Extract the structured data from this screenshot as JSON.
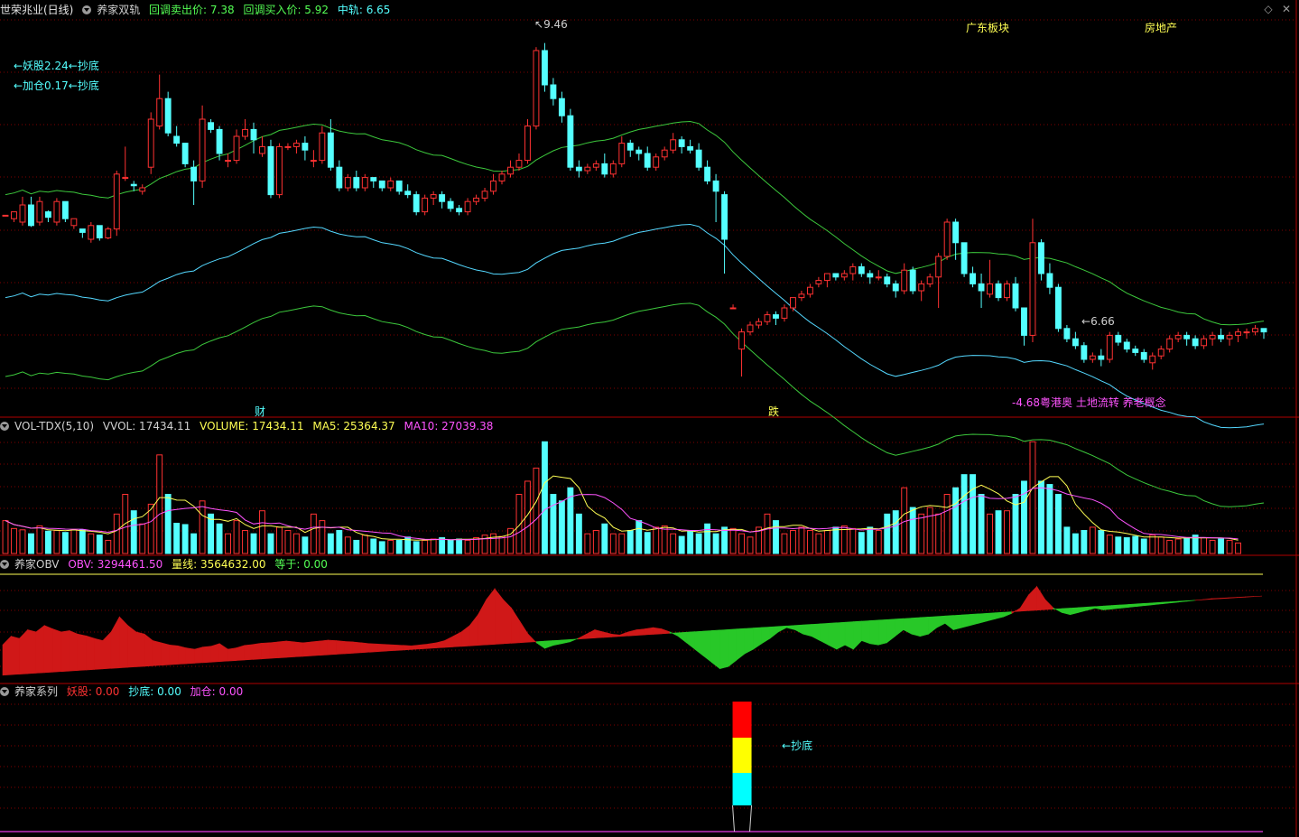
{
  "main": {
    "stock_title": "世荣兆业(日线)",
    "indicator_name": "养家双轨",
    "sell_label": "回调卖出价: 7.38",
    "buy_label": "回调买入价: 5.92",
    "mid_label": "中轨: 6.65",
    "sector_label": "广东板块",
    "industry_label": "房地产",
    "note1": "←妖股2.24←抄底",
    "note2": "←加仓0.17←抄底",
    "high_marker": "9.46",
    "low_marker": "6.66",
    "event_cai": "财",
    "event_die": "跌",
    "concept_text": "-4.68粤港奥 土地流转 养老概念"
  },
  "vol_panel": {
    "name": "VOL-TDX(5,10)",
    "vvol": "VVOL: 17434.11",
    "volume": "VOLUME: 17434.11",
    "ma5": "MA5: 25364.37",
    "ma10": "MA10: 27039.38"
  },
  "obv_panel": {
    "name": "养家OBV",
    "obv": "OBV: 3294461.50",
    "liangxian": "量线: 3564632.00",
    "dengyu": "等于: 0.00"
  },
  "series_panel": {
    "name": "养家系列",
    "yaogu": "妖股: 0.00",
    "chaodi": "抄底: 0.00",
    "jiacang": "加仓: 0.00",
    "signal_label": "抄底"
  },
  "colors": {
    "up": "#ff3232",
    "down": "#54ffff",
    "upper_band": "#3cc83c",
    "mid_band": "#54d8ff",
    "ma5": "#ffff54",
    "ma10": "#ff54ff",
    "obv_up": "#d01818",
    "obv_down": "#28c828",
    "grid": "#800000"
  },
  "chart_data": {
    "type": "candlestick",
    "candles": [
      [
        6.95,
        6.95,
        6.95,
        6.95
      ],
      [
        6.9,
        7.0,
        7.0,
        6.85
      ],
      [
        6.85,
        7.22,
        7.1,
        6.8
      ],
      [
        7.1,
        7.22,
        6.8,
        6.78
      ],
      [
        6.85,
        7.22,
        7.15,
        6.8
      ],
      [
        7.0,
        7.02,
        6.92,
        6.85
      ],
      [
        6.85,
        7.2,
        7.15,
        6.8
      ],
      [
        7.15,
        7.15,
        6.9,
        6.85
      ],
      [
        6.8,
        6.9,
        6.9,
        6.75
      ],
      [
        6.75,
        6.75,
        6.7,
        6.62
      ],
      [
        6.6,
        6.85,
        6.8,
        6.55
      ],
      [
        6.8,
        6.8,
        6.62,
        6.58
      ],
      [
        6.62,
        6.78,
        6.75,
        6.6
      ],
      [
        6.75,
        7.6,
        7.55,
        6.65
      ],
      [
        7.5,
        7.95,
        7.5,
        7.45
      ],
      [
        7.4,
        7.45,
        7.38,
        7.3
      ],
      [
        7.3,
        7.4,
        7.35,
        7.25
      ],
      [
        7.65,
        8.45,
        8.35,
        7.55
      ],
      [
        8.25,
        9.0,
        8.65,
        8.2
      ],
      [
        8.65,
        8.75,
        8.15,
        8.1
      ],
      [
        8.1,
        8.25,
        8.0,
        7.95
      ],
      [
        8.0,
        8.0,
        7.7,
        7.65
      ],
      [
        7.65,
        7.75,
        7.45,
        7.1
      ],
      [
        7.45,
        8.55,
        8.35,
        7.35
      ],
      [
        8.3,
        8.35,
        8.2,
        8.15
      ],
      [
        8.2,
        8.25,
        7.85,
        7.75
      ],
      [
        7.75,
        7.85,
        7.75,
        7.65
      ],
      [
        7.75,
        8.2,
        8.1,
        7.7
      ],
      [
        8.1,
        8.35,
        8.2,
        8.05
      ],
      [
        8.2,
        8.3,
        8.05,
        7.85
      ],
      [
        7.85,
        8.1,
        7.95,
        7.8
      ],
      [
        7.95,
        8.05,
        7.25,
        7.2
      ],
      [
        7.25,
        8.0,
        7.95,
        7.2
      ],
      [
        7.95,
        8.0,
        7.95,
        7.9
      ],
      [
        7.95,
        8.05,
        8.0,
        7.85
      ],
      [
        8.0,
        8.1,
        7.9,
        7.75
      ],
      [
        7.75,
        7.9,
        7.75,
        7.65
      ],
      [
        7.75,
        8.25,
        8.15,
        7.7
      ],
      [
        8.15,
        8.35,
        7.65,
        7.6
      ],
      [
        7.65,
        7.75,
        7.35,
        7.3
      ],
      [
        7.35,
        7.55,
        7.5,
        7.3
      ],
      [
        7.5,
        7.6,
        7.35,
        7.3
      ],
      [
        7.35,
        7.55,
        7.5,
        7.3
      ],
      [
        7.5,
        7.5,
        7.45,
        7.35
      ],
      [
        7.45,
        7.45,
        7.35,
        7.3
      ],
      [
        7.35,
        7.5,
        7.45,
        7.3
      ],
      [
        7.45,
        7.45,
        7.3,
        7.25
      ],
      [
        7.3,
        7.4,
        7.25,
        7.2
      ],
      [
        7.25,
        7.3,
        7.0,
        6.95
      ],
      [
        7.0,
        7.25,
        7.2,
        6.95
      ],
      [
        7.2,
        7.3,
        7.25,
        7.1
      ],
      [
        7.25,
        7.3,
        7.15,
        7.05
      ],
      [
        7.15,
        7.2,
        7.05,
        7.0
      ],
      [
        7.05,
        7.1,
        7.0,
        6.95
      ],
      [
        7.0,
        7.2,
        7.15,
        6.95
      ],
      [
        7.15,
        7.25,
        7.2,
        7.1
      ],
      [
        7.2,
        7.35,
        7.3,
        7.15
      ],
      [
        7.3,
        7.55,
        7.45,
        7.25
      ],
      [
        7.45,
        7.6,
        7.55,
        7.4
      ],
      [
        7.55,
        7.75,
        7.65,
        7.5
      ],
      [
        7.65,
        7.85,
        7.75,
        7.6
      ],
      [
        7.75,
        8.35,
        8.25,
        7.7
      ],
      [
        8.25,
        9.4,
        9.35,
        8.2
      ],
      [
        9.35,
        9.46,
        8.85,
        8.75
      ],
      [
        8.85,
        8.95,
        8.65,
        8.55
      ],
      [
        8.65,
        8.75,
        8.4,
        8.3
      ],
      [
        8.4,
        8.5,
        7.65,
        7.6
      ],
      [
        7.65,
        7.75,
        7.6,
        7.5
      ],
      [
        7.6,
        7.7,
        7.65,
        7.55
      ],
      [
        7.65,
        7.75,
        7.7,
        7.6
      ],
      [
        7.7,
        7.85,
        7.55,
        7.5
      ],
      [
        7.55,
        7.75,
        7.7,
        7.5
      ],
      [
        7.7,
        8.1,
        8.0,
        7.65
      ],
      [
        8.0,
        8.05,
        7.9,
        7.8
      ],
      [
        7.9,
        7.95,
        7.85,
        7.75
      ],
      [
        7.85,
        7.95,
        7.65,
        7.6
      ],
      [
        7.65,
        7.85,
        7.8,
        7.6
      ],
      [
        7.8,
        7.95,
        7.9,
        7.75
      ],
      [
        7.9,
        8.15,
        8.05,
        7.85
      ],
      [
        8.05,
        8.1,
        7.95,
        7.85
      ],
      [
        7.95,
        8.05,
        7.9,
        7.85
      ],
      [
        7.9,
        8.0,
        7.65,
        7.6
      ],
      [
        7.65,
        7.75,
        7.45,
        7.4
      ],
      [
        7.45,
        7.55,
        7.3,
        6.85
      ],
      [
        7.25,
        7.3,
        6.6,
        6.1
      ],
      [
        5.6,
        5.65,
        5.6,
        5.6
      ],
      [
        5.0,
        5.3,
        5.25,
        4.6
      ],
      [
        5.25,
        5.4,
        5.35,
        5.2
      ],
      [
        5.35,
        5.45,
        5.4,
        5.3
      ],
      [
        5.4,
        5.55,
        5.5,
        5.35
      ],
      [
        5.5,
        5.55,
        5.45,
        5.35
      ],
      [
        5.45,
        5.65,
        5.6,
        5.4
      ],
      [
        5.6,
        5.75,
        5.75,
        5.55
      ],
      [
        5.75,
        5.85,
        5.8,
        5.7
      ],
      [
        5.8,
        5.95,
        5.9,
        5.75
      ],
      [
        5.95,
        6.05,
        6.0,
        5.9
      ],
      [
        6.0,
        6.1,
        6.1,
        5.9
      ],
      [
        6.1,
        6.1,
        6.05,
        6.0
      ],
      [
        6.05,
        6.15,
        6.1,
        6.0
      ],
      [
        6.1,
        6.25,
        6.2,
        6.0
      ],
      [
        6.2,
        6.25,
        6.1,
        6.05
      ],
      [
        6.1,
        6.15,
        6.05,
        5.95
      ],
      [
        6.05,
        6.15,
        6.05,
        6.0
      ],
      [
        6.05,
        6.1,
        5.95,
        5.9
      ],
      [
        5.95,
        6.0,
        5.85,
        5.75
      ],
      [
        5.85,
        6.25,
        6.15,
        5.8
      ],
      [
        6.15,
        6.2,
        5.85,
        5.8
      ],
      [
        5.85,
        6.0,
        5.95,
        5.7
      ],
      [
        5.95,
        6.1,
        6.05,
        5.9
      ],
      [
        6.05,
        6.4,
        6.35,
        5.6
      ],
      [
        6.35,
        6.9,
        6.85,
        6.3
      ],
      [
        6.85,
        6.9,
        6.55,
        6.3
      ],
      [
        6.55,
        6.55,
        6.1,
        6.05
      ],
      [
        6.1,
        6.2,
        5.95,
        5.9
      ],
      [
        5.95,
        6.1,
        5.85,
        5.6
      ],
      [
        5.8,
        6.3,
        5.95,
        5.75
      ],
      [
        5.95,
        6.0,
        5.75,
        5.7
      ],
      [
        5.75,
        6.0,
        5.95,
        5.7
      ],
      [
        5.95,
        6.05,
        5.6,
        5.55
      ],
      [
        5.6,
        5.6,
        5.2,
        5.05
      ],
      [
        5.2,
        6.9,
        6.55,
        5.1
      ],
      [
        6.55,
        6.6,
        6.1,
        6.0
      ],
      [
        6.1,
        6.25,
        5.9,
        5.8
      ],
      [
        5.9,
        5.95,
        5.3,
        5.25
      ],
      [
        5.3,
        5.35,
        5.15,
        5.1
      ],
      [
        5.15,
        5.25,
        5.05,
        5.0
      ],
      [
        5.05,
        5.1,
        4.85,
        4.8
      ],
      [
        4.85,
        4.95,
        4.9,
        4.8
      ],
      [
        4.9,
        5.0,
        4.85,
        4.75
      ],
      [
        4.85,
        5.25,
        5.2,
        4.8
      ],
      [
        5.2,
        5.25,
        5.1,
        5.05
      ],
      [
        5.1,
        5.15,
        5.0,
        4.95
      ],
      [
        5.0,
        5.05,
        4.95,
        4.9
      ],
      [
        4.95,
        5.0,
        4.85,
        4.8
      ],
      [
        4.8,
        4.95,
        4.9,
        4.7
      ],
      [
        4.9,
        5.05,
        5.0,
        4.85
      ],
      [
        5.0,
        5.2,
        5.15,
        4.95
      ],
      [
        5.15,
        5.25,
        5.2,
        5.1
      ],
      [
        5.2,
        5.25,
        5.15,
        5.05
      ],
      [
        5.15,
        5.2,
        5.05,
        5.0
      ],
      [
        5.05,
        5.2,
        5.15,
        5.0
      ],
      [
        5.15,
        5.25,
        5.2,
        5.05
      ],
      [
        5.2,
        5.3,
        5.15,
        5.1
      ],
      [
        5.15,
        5.25,
        5.2,
        5.05
      ],
      [
        5.2,
        5.3,
        5.25,
        5.1
      ],
      [
        5.25,
        5.3,
        5.25,
        5.15
      ],
      [
        5.25,
        5.35,
        5.3,
        5.2
      ],
      [
        5.3,
        5.3,
        5.25,
        5.15
      ]
    ],
    "upper_band_y_range": [
      6.7,
      8.25
    ],
    "price_ylim": [
      4.1,
      9.85
    ],
    "volume": [
      5.0,
      3.8,
      3.6,
      3.0,
      4.2,
      3.4,
      3.5,
      3.2,
      3.6,
      3.6,
      3.0,
      2.8,
      2.0,
      6.0,
      9.0,
      6.5,
      4.5,
      7.5,
      15.0,
      9.0,
      4.6,
      4.4,
      3.0,
      8.0,
      6.0,
      4.5,
      3.0,
      5.0,
      3.5,
      3.0,
      6.5,
      3.0,
      4.0,
      3.5,
      3.0,
      2.5,
      6.0,
      5.0,
      3.0,
      3.5,
      2.5,
      2.0,
      2.8,
      2.2,
      1.8,
      2.0,
      2.0,
      2.5,
      1.8,
      2.0,
      2.2,
      2.4,
      2.0,
      2.2,
      2.0,
      2.4,
      2.8,
      3.0,
      2.6,
      3.8,
      9.0,
      11.0,
      13.0,
      17.0,
      9.0,
      8.0,
      10.0,
      6.0,
      3.0,
      3.5,
      4.5,
      3.0,
      3.0,
      3.5,
      5.0,
      3.2,
      4.0,
      4.2,
      3.0,
      2.6,
      3.5,
      3.0,
      4.5,
      3.0,
      4.0,
      3.8,
      3.0,
      2.5,
      4.0,
      6.0,
      5.0,
      3.0,
      3.5,
      4.0,
      3.5,
      3.0,
      3.5,
      4.0,
      4.2,
      3.8,
      3.2,
      4.0,
      3.5,
      6.0,
      6.5,
      10.0,
      7.0,
      6.0,
      7.0,
      6.0,
      9.0,
      10.0,
      12.0,
      12.0,
      9.0,
      6.0,
      6.5,
      6.5,
      9.0,
      11.0,
      17.0,
      11.0,
      10.5,
      9.0,
      4.0,
      3.0,
      3.5,
      4.0,
      3.5,
      2.8,
      2.5,
      2.4,
      2.6,
      2.2,
      2.8,
      2.5,
      2.0,
      2.2,
      2.4,
      2.8,
      2.4,
      2.0,
      2.2,
      2.0,
      1.6
    ],
    "vol_ylim": [
      0,
      18
    ],
    "obv_series": [
      0.5,
      2.5,
      2.0,
      4.0,
      3.5,
      5.0,
      4.2,
      3.5,
      3.8,
      3.0,
      2.6,
      2.0,
      1.5,
      3.5,
      7.0,
      5.0,
      3.5,
      3.0,
      1.5,
      1.0,
      0.5,
      0.3,
      -0.2,
      -0.5,
      0.0,
      0.2,
      0.8,
      -0.5,
      -0.2,
      0.4,
      0.6,
      0.9,
      1.0,
      1.2,
      1.4,
      1.2,
      1.0,
      1.2,
      1.4,
      1.6,
      1.5,
      1.3,
      1.2,
      1.0,
      0.8,
      0.7,
      0.6,
      0.5,
      0.4,
      0.3,
      0.5,
      0.7,
      1.0,
      1.5,
      2.5,
      3.5,
      5.0,
      7.5,
      11.0,
      13.5,
      11.0,
      9.0,
      6.0,
      3.0,
      1.0,
      -0.3,
      0.4,
      0.8,
      1.2,
      2.0,
      3.0,
      4.0,
      3.5,
      3.0,
      2.8,
      3.5,
      4.0,
      4.2,
      4.5,
      4.2,
      3.5,
      2.5,
      1.0,
      -0.5,
      -2.0,
      -3.5,
      -5.0,
      -4.5,
      -3.0,
      -1.5,
      -0.5,
      0.8,
      2.0,
      3.5,
      4.5,
      4.0,
      3.0,
      2.5,
      1.5,
      0.5,
      -0.5,
      0.5,
      -0.5,
      1.5,
      0.8,
      0.5,
      1.0,
      2.5,
      4.0,
      3.0,
      2.5,
      3.0,
      4.5,
      5.5,
      4.0,
      4.5,
      5.0,
      5.5,
      6.0,
      6.5,
      7.0,
      7.8,
      9.0,
      12.0,
      14.0,
      11.0,
      9.0,
      8.0,
      7.5,
      8.0,
      8.5,
      9.0,
      8.6,
      8.8,
      9.0,
      9.2,
      9.4,
      9.6,
      9.8,
      10.0,
      10.2,
      10.4,
      10.6,
      10.8,
      11.0,
      11.2,
      11.3,
      11.4,
      11.5,
      11.6,
      11.7,
      11.8
    ],
    "obv_ylim": [
      -8,
      16
    ],
    "signal_index": 86
  }
}
